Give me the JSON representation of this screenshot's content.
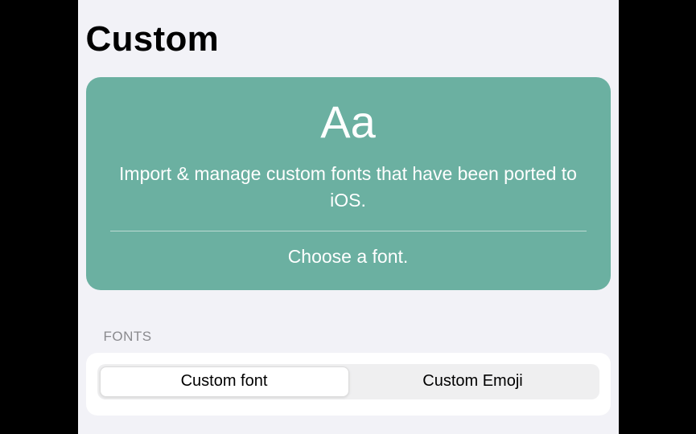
{
  "title": "Custom",
  "hero": {
    "sample": "Aa",
    "description": "Import & manage custom fonts that have been ported to iOS.",
    "choose": "Choose a font."
  },
  "fonts": {
    "header": "FONTS",
    "segments": [
      {
        "label": "Custom font",
        "selected": true
      },
      {
        "label": "Custom Emoji",
        "selected": false
      }
    ]
  }
}
